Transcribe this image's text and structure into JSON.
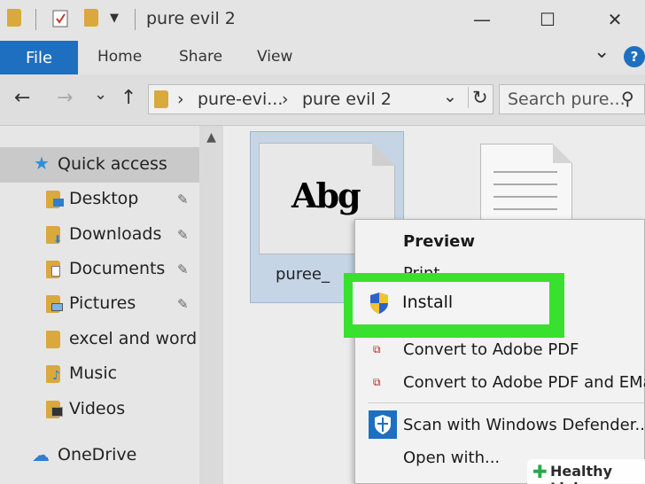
{
  "window": {
    "title": "pure evil 2",
    "minimize_glyph": "—",
    "maximize_glyph": "☐",
    "close_glyph": "✕"
  },
  "ribbon": {
    "file": "File",
    "home": "Home",
    "share": "Share",
    "view": "View",
    "help": "?",
    "expand_glyph": "⌄"
  },
  "nav": {
    "back": "←",
    "forward": "→",
    "recent": "⌄",
    "up": "↑",
    "crumb_sep": "›",
    "breadcrumb": [
      "pure-evi...",
      "pure evil 2"
    ],
    "dropdown_glyph": "⌄",
    "refresh_glyph": "↻",
    "search_placeholder": "Search pure...",
    "search_glyph": "⚲",
    "scroll_up_glyph": "▲"
  },
  "sidebar": {
    "pin_glyph": "📌",
    "items": [
      {
        "label": "Quick access",
        "icon": "star-icon"
      },
      {
        "label": "Desktop",
        "icon": "desktop-folder-icon",
        "pinned": true
      },
      {
        "label": "Downloads",
        "icon": "downloads-folder-icon",
        "pinned": true
      },
      {
        "label": "Documents",
        "icon": "documents-folder-icon",
        "pinned": true
      },
      {
        "label": "Pictures",
        "icon": "pictures-folder-icon",
        "pinned": true
      },
      {
        "label": "excel and word",
        "icon": "folder-icon"
      },
      {
        "label": "Music",
        "icon": "music-folder-icon"
      },
      {
        "label": "Videos",
        "icon": "videos-folder-icon"
      },
      {
        "label": "OneDrive",
        "icon": "cloud-icon"
      }
    ]
  },
  "files": [
    {
      "name": "puree_",
      "thumbnail_text": "Abg",
      "selected": true
    }
  ],
  "context_menu": {
    "items": [
      "Preview",
      "Print",
      "Install",
      "Convert to Adobe PDF",
      "Convert to Adobe PDF and EMa",
      "Scan with Windows Defender...",
      "Open with..."
    ],
    "highlighted": "Install"
  },
  "colors": {
    "accent": "#1e6fc0",
    "highlight": "#37e12d",
    "selection": "#c5d5e6"
  },
  "watermark": {
    "plus": "✚",
    "text": "Healthy Living"
  }
}
